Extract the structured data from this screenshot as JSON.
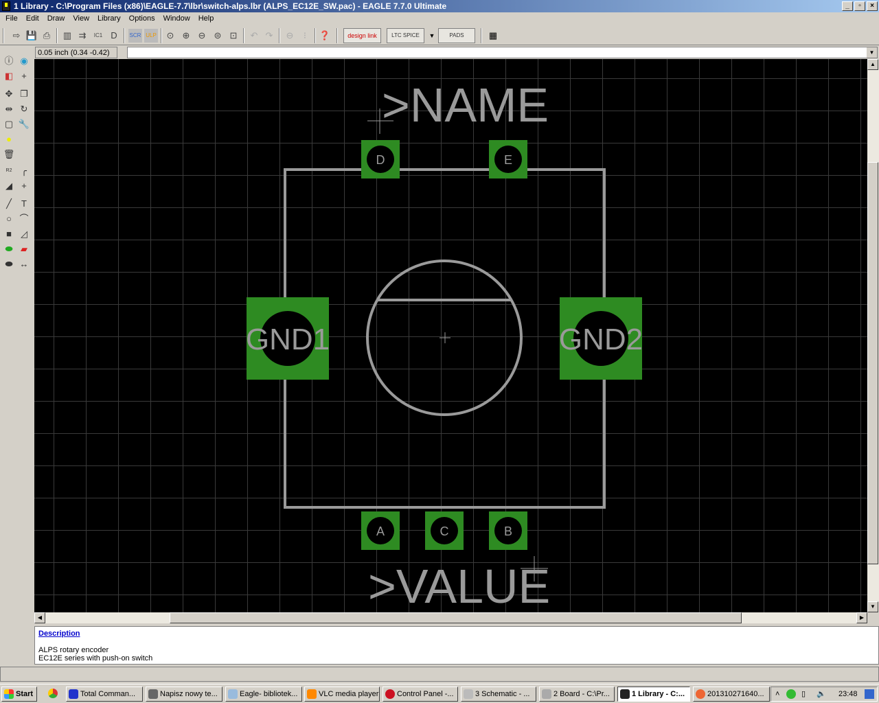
{
  "window": {
    "title": "1 Library - C:\\Program Files (x86)\\EAGLE-7.7\\lbr\\switch-alps.lbr (ALPS_EC12E_SW.pac) - EAGLE 7.7.0 Ultimate",
    "min": "_",
    "max": "▫",
    "close": "×"
  },
  "menu": [
    "File",
    "Edit",
    "Draw",
    "View",
    "Library",
    "Options",
    "Window",
    "Help"
  ],
  "toolbar": {
    "designlink": "design link",
    "ltspice": "LTC SPICE",
    "pads": "PADS",
    "scr": "SCR",
    "ulp": "ULP",
    "ic1": "IC1"
  },
  "coord": "0.05 inch (0.34 -0.42)",
  "command": "",
  "package": {
    "name_label": ">NAME",
    "value_label": ">VALUE",
    "pads": [
      {
        "name": "D"
      },
      {
        "name": "E"
      },
      {
        "name": "A"
      },
      {
        "name": "C"
      },
      {
        "name": "B"
      },
      {
        "name": "GND1"
      },
      {
        "name": "GND2"
      }
    ],
    "pad_color": "#2e8b22",
    "outline_color": "#9a9a9a"
  },
  "description": {
    "heading": "Description",
    "line1": "ALPS rotary encoder",
    "line2": "EC12E series with push-on switch"
  },
  "taskbar": {
    "start": "Start",
    "tasks": [
      "Total Comman...",
      "Napisz nowy te...",
      "Eagle- bibliotek...",
      "VLC media player",
      "Control Panel -...",
      "3 Schematic - ...",
      "2 Board - C:\\Pr...",
      "1 Library - C:...",
      "201310271640..."
    ],
    "clock": "23:48"
  }
}
